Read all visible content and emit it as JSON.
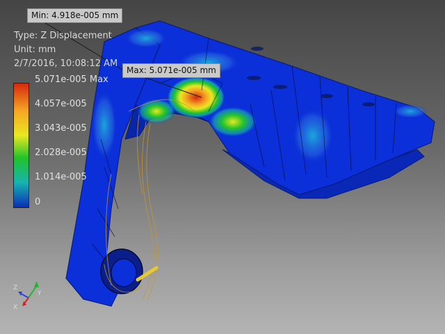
{
  "result_info": {
    "type_line": "Type: Z Displacement",
    "unit_line": "Unit: mm",
    "date_line": "2/7/2016, 10:08:12 AM"
  },
  "legend": {
    "labels": [
      "5.071e-005 Max",
      "4.057e-005",
      "3.043e-005",
      "2.028e-005",
      "1.014e-005",
      "0"
    ],
    "colors": {
      "max": "#d42a0c",
      "high": "#f5a623",
      "mid_high": "#e8e820",
      "mid": "#22c42b",
      "low": "#17b3b0",
      "min": "#0a2fb8"
    }
  },
  "probes": {
    "min_label": "Min: 4.918e-005 mm",
    "max_label": "Max: 5.071e-005 mm"
  },
  "triad": {
    "x_label": "X",
    "y_label": "Y",
    "z_label": "Z"
  },
  "colors": {
    "part_base": "#0b2fd8",
    "wireframe": "#c8962e",
    "background_top": "#454545",
    "background_bottom": "#b4b4b4"
  }
}
